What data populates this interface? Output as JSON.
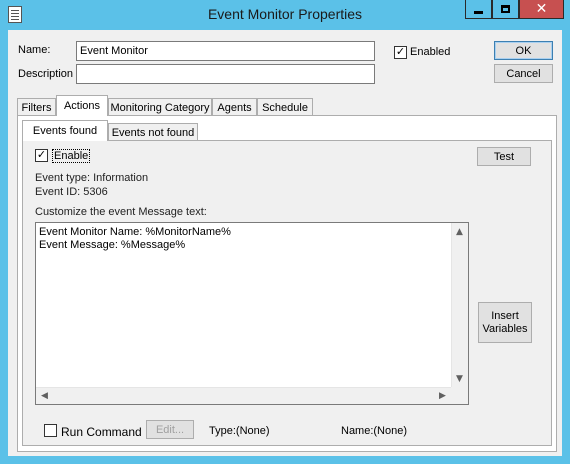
{
  "window": {
    "title": "Event Monitor Properties",
    "minimize_icon": "minimize-icon",
    "maximize_icon": "maximize-icon",
    "close_icon": "close-icon",
    "close_glyph": "✕"
  },
  "form": {
    "name_label": "Name:",
    "name_value": "Event Monitor",
    "description_label": "Description",
    "description_value": "",
    "enabled_label": "Enabled",
    "enabled_checked": true,
    "ok_label": "OK",
    "cancel_label": "Cancel"
  },
  "tabs": [
    {
      "label": "Filters"
    },
    {
      "label": "Actions",
      "active": true
    },
    {
      "label": "Monitoring Category"
    },
    {
      "label": "Agents"
    },
    {
      "label": "Schedule"
    }
  ],
  "subtabs": [
    {
      "label": "Events found",
      "active": true
    },
    {
      "label": "Events not found"
    }
  ],
  "actions": {
    "enable_label": "Enable",
    "enable_checked": true,
    "test_label": "Test",
    "event_type": "Event type: Information",
    "event_id": "Event ID: 5306",
    "customize_label": "Customize the event Message text:",
    "message_line1": "Event Monitor Name: %MonitorName%",
    "message_line2": "Event Message: %Message%",
    "insert_label_1": "Insert",
    "insert_label_2": "Variables",
    "run_command_label": "Run Command",
    "run_command_checked": false,
    "edit_label": "Edit...",
    "type_text": "Type:(None)",
    "name_text": "Name:(None)"
  },
  "colors": {
    "accent": "#5bc1e8",
    "close": "#c75050",
    "face": "#f0f0f0"
  }
}
